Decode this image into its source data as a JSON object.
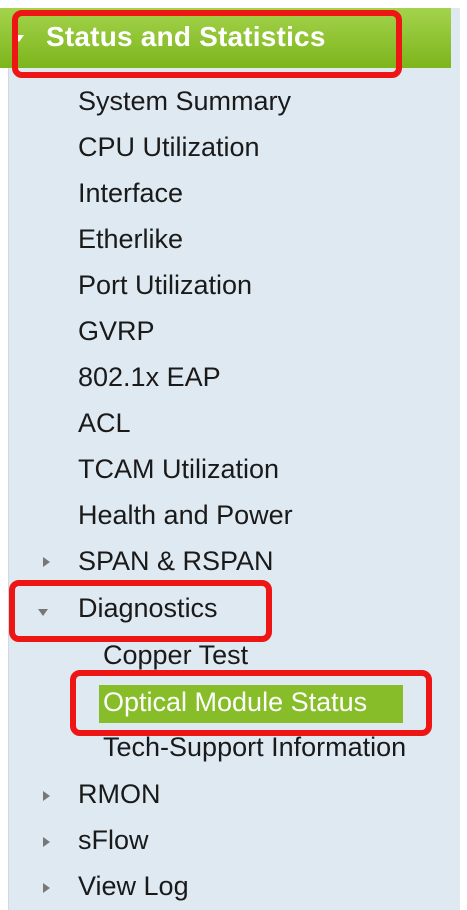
{
  "header": {
    "label": "Status and Statistics"
  },
  "items": {
    "system_summary": "System Summary",
    "cpu_utilization": "CPU Utilization",
    "interface": "Interface",
    "etherlike": "Etherlike",
    "port_utilization": "Port Utilization",
    "gvrp": "GVRP",
    "eap": "802.1x EAP",
    "acl": "ACL",
    "tcam_utilization": "TCAM Utilization",
    "health_power": "Health and Power",
    "span_rspan": "SPAN & RSPAN",
    "diagnostics": "Diagnostics",
    "copper_test": "Copper Test",
    "optical_module_status": "Optical Module Status",
    "tech_support": "Tech-Support Information",
    "rmon": "RMON",
    "sflow": "sFlow",
    "view_log": "View Log"
  },
  "colors": {
    "header_green": "#7cb51c",
    "highlight_green": "#86bd29",
    "annotation_red": "#ee1515",
    "panel_bg": "#dfe9f1"
  },
  "icons": {
    "expanded": "triangle-down-icon",
    "collapsed": "triangle-right-icon"
  }
}
